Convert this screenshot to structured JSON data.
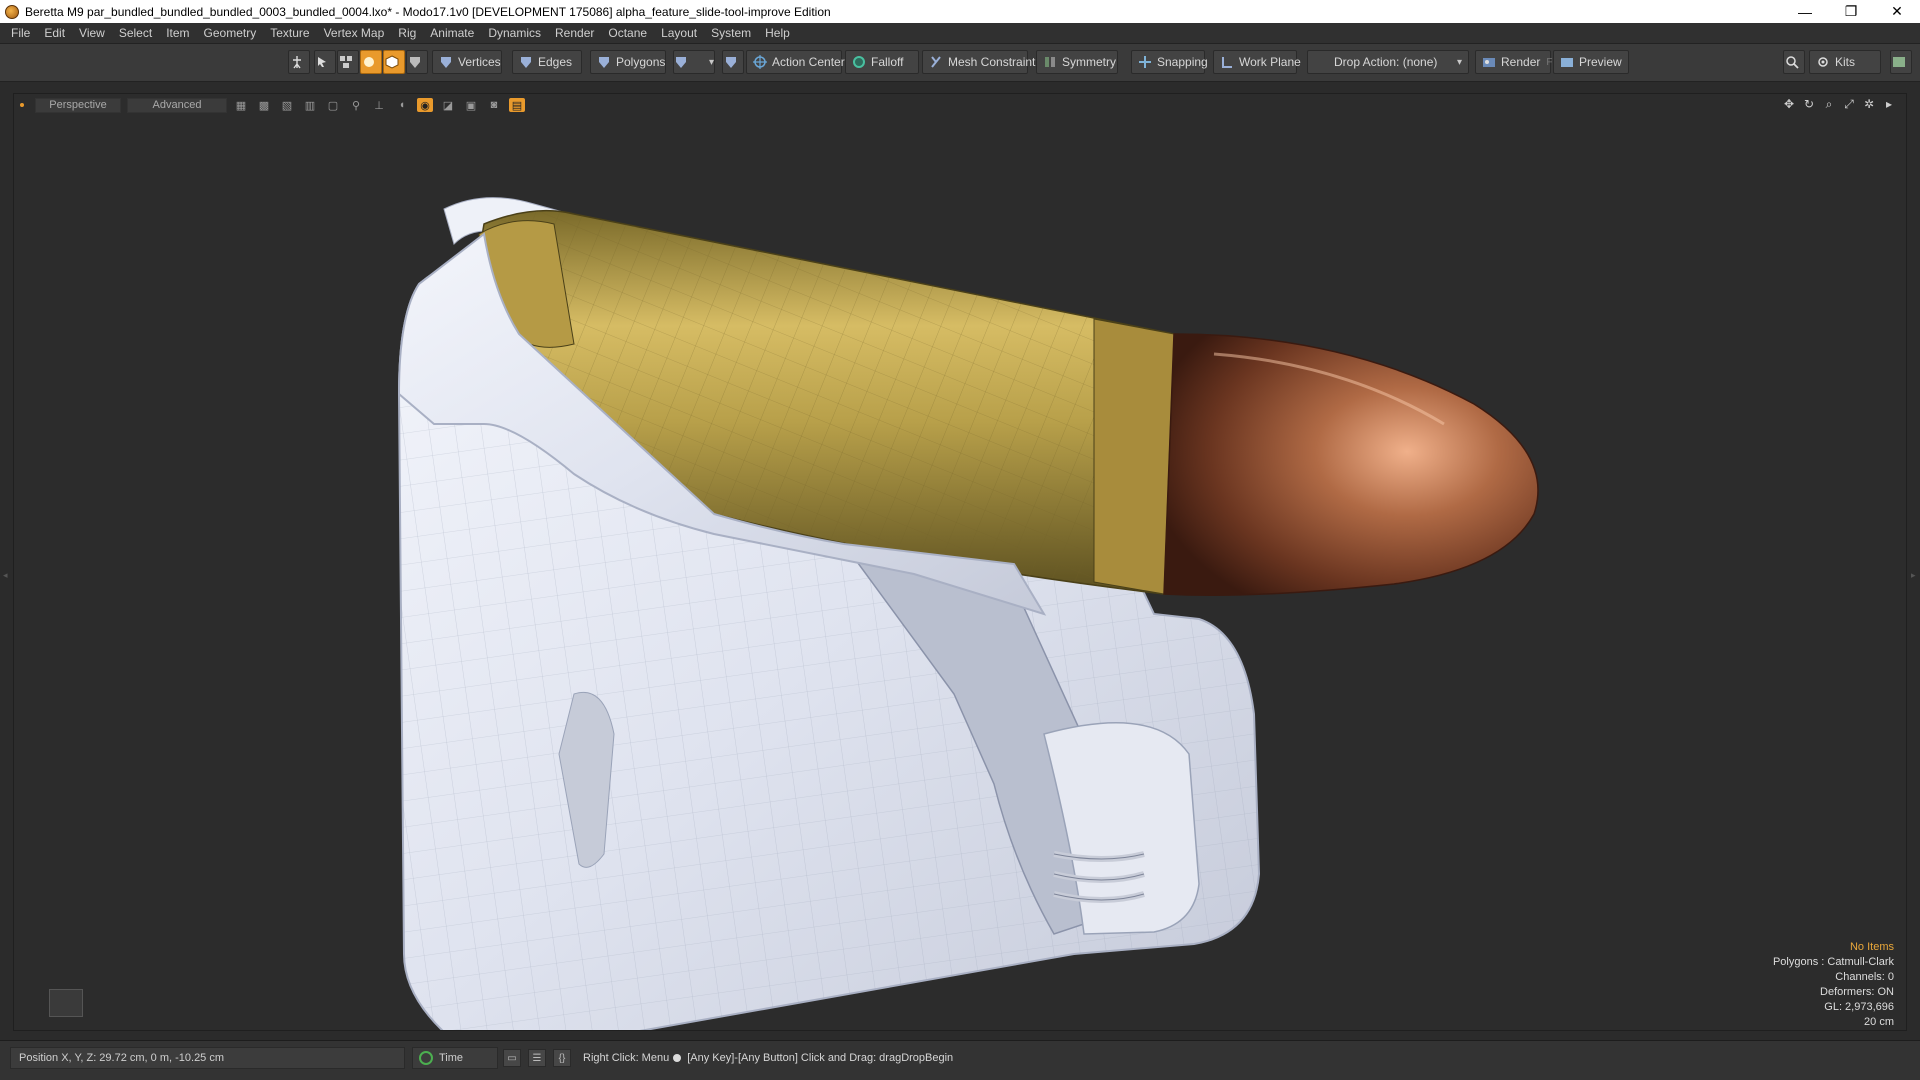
{
  "window": {
    "title": "Beretta M9 par_bundled_bundled_bundled_0003_bundled_0004.lxo* - Modo17.1v0 [DEVELOPMENT 175086]   alpha_feature_slide-tool-improve Edition",
    "minimize": "—",
    "restore": "❐",
    "close": "✕"
  },
  "menu": [
    "File",
    "Edit",
    "View",
    "Select",
    "Item",
    "Geometry",
    "Texture",
    "Vertex Map",
    "Rig",
    "Animate",
    "Dynamics",
    "Render",
    "Octane",
    "Layout",
    "System",
    "Help"
  ],
  "toolbar": {
    "vertices": "Vertices",
    "edges": "Edges",
    "polygons": "Polygons",
    "action_center": "Action Center",
    "falloff": "Falloff",
    "mesh_constraint": "Mesh Constraint",
    "symmetry": "Symmetry",
    "snapping": "Snapping",
    "work_plane": "Work Plane",
    "drop_action": "Drop Action: (none)",
    "render": "Render",
    "render_shortcut": "F9",
    "preview": "Preview",
    "kits": "Kits"
  },
  "viewport": {
    "view_mode": "Perspective",
    "shading_mode": "Advanced"
  },
  "info": {
    "selection": "No Items",
    "polygons": "Polygons : Catmull-Clark",
    "channels": "Channels: 0",
    "deformers": "Deformers: ON",
    "gl": "GL: 2,973,696",
    "grid": "20 cm"
  },
  "status": {
    "position": "Position X, Y, Z:   29.72 cm, 0 m, -10.25 cm",
    "time": "Time",
    "hint_right": "Right Click: Menu",
    "hint_drag": "[Any Key]-[Any Button] Click and Drag: dragDropBegin"
  },
  "colors": {
    "accent": "#e99a2c",
    "background": "#2c2c2c",
    "brass": "#c8a24a",
    "copper": "#9c5a3a",
    "mesh": "#e8ebf3"
  }
}
